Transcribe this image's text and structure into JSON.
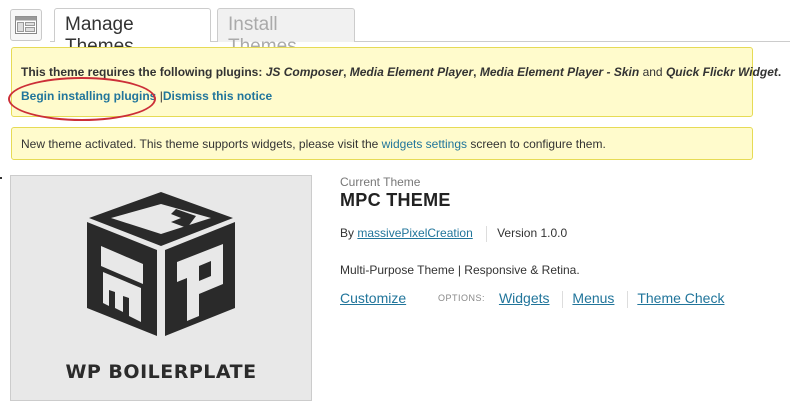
{
  "header": {
    "tabs": [
      {
        "label": "Manage Themes",
        "active": true
      },
      {
        "label": "Install Themes",
        "active": false
      }
    ],
    "icon": "appearance-icon"
  },
  "notice_plugins": {
    "prefix": "This theme requires the following plugins:",
    "plugins": [
      "JS Composer",
      "Media Element Player",
      "Media Element Player - Skin",
      "Quick Flickr Widget"
    ],
    "sep_comma_1": ",",
    "sep_comma_2": ",",
    "sep_and": "and",
    "suffix": ".",
    "begin_label": "Begin installing plugins",
    "divider": "|",
    "dismiss_label": "Dismiss this notice"
  },
  "notice_activated": {
    "before": "New theme activated. This theme supports widgets, please visit the",
    "link": "widgets settings",
    "after": "screen to configure them."
  },
  "thumbnail": {
    "caption": "WP BOILERPLATE"
  },
  "current_theme": {
    "label": "Current Theme",
    "name": "MPC THEME",
    "by": "By",
    "author": "massivePixelCreation",
    "version": "Version 1.0.0",
    "description": "Multi-Purpose Theme | Responsive & Retina.",
    "customize": "Customize",
    "options_label": "OPTIONS:",
    "options": [
      "Widgets",
      "Menus",
      "Theme Check"
    ]
  },
  "colors": {
    "link": "#21759b",
    "notice_bg": "#fffbcc",
    "notice_border": "#e6db55",
    "highlight": "#cc2f38"
  }
}
